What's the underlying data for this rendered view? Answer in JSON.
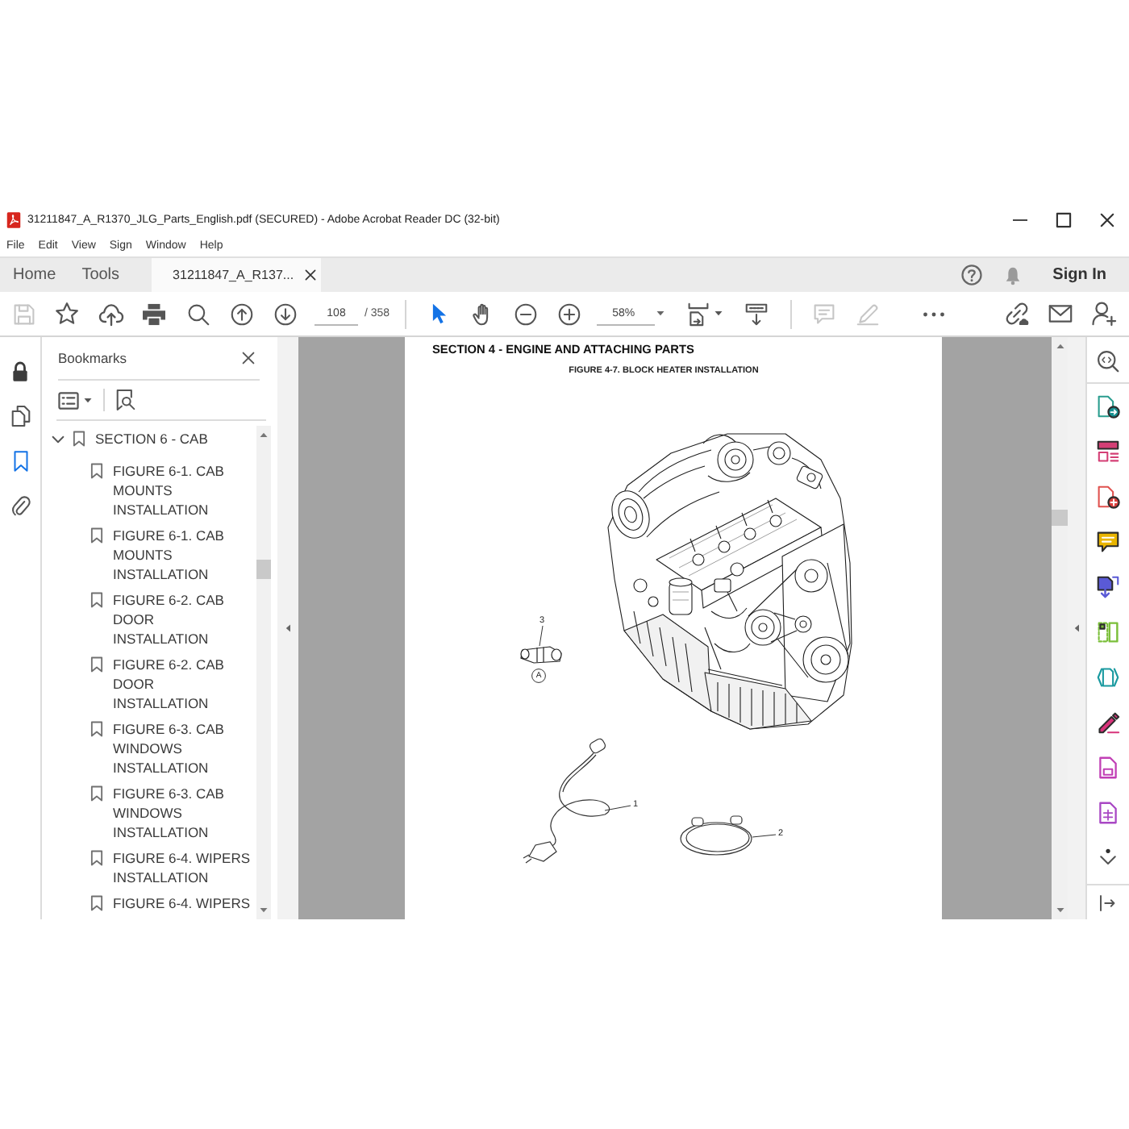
{
  "window": {
    "title": "31211847_A_R1370_JLG_Parts_English.pdf (SECURED) - Adobe Acrobat Reader DC (32-bit)"
  },
  "menu": [
    "File",
    "Edit",
    "View",
    "Sign",
    "Window",
    "Help"
  ],
  "tabs": [
    {
      "label": "Home",
      "kind": "nav",
      "selected": false
    },
    {
      "label": "Tools",
      "kind": "nav",
      "selected": false
    },
    {
      "label": "31211847_A_R137...",
      "kind": "document",
      "selected": true
    }
  ],
  "account": {
    "sign_in": "Sign In"
  },
  "toolbar": {
    "save": {
      "disabled": true
    },
    "page": {
      "current": "108",
      "total": "/ 358"
    },
    "pointer_tools": [
      {
        "selected": true
      },
      {
        "selected": false
      }
    ],
    "zoom": "58%",
    "comment_tools": [
      {
        "disabled": true
      },
      {
        "disabled": true
      }
    ]
  },
  "side_panel_tabs": [
    {
      "selected": false
    },
    {
      "selected": true
    },
    {
      "selected": false
    }
  ],
  "bookmarks": {
    "title": "Bookmarks",
    "tree": [
      {
        "label": "SECTION 6 - CAB",
        "selected": false,
        "expanded": true,
        "children": [
          {
            "label": "FIGURE 6-1. CAB MOUNTS INSTALLATION",
            "selected": false
          },
          {
            "label": "FIGURE 6-1. CAB MOUNTS INSTALLATION",
            "selected": false
          },
          {
            "label": "FIGURE 6-2. CAB DOOR INSTALLATION",
            "selected": false
          },
          {
            "label": "FIGURE 6-2. CAB DOOR INSTALLATION",
            "selected": false
          },
          {
            "label": "FIGURE 6-3. CAB WINDOWS INSTALLATION",
            "selected": false
          },
          {
            "label": "FIGURE 6-3. CAB WINDOWS INSTALLATION",
            "selected": false
          },
          {
            "label": "FIGURE 6-4. WIPERS INSTALLATION",
            "selected": false
          },
          {
            "label": "FIGURE 6-4. WIPERS",
            "selected": false
          }
        ]
      }
    ]
  },
  "document": {
    "section_title": "SECTION 4 - ENGINE AND ATTACHING PARTS",
    "figure_title": "FIGURE 4-7. BLOCK HEATER INSTALLATION",
    "callouts": [
      {
        "label": "3",
        "kind": "item"
      },
      {
        "label": "A",
        "kind": "view"
      },
      {
        "label": "1",
        "kind": "item"
      },
      {
        "label": "2",
        "kind": "item"
      }
    ]
  }
}
